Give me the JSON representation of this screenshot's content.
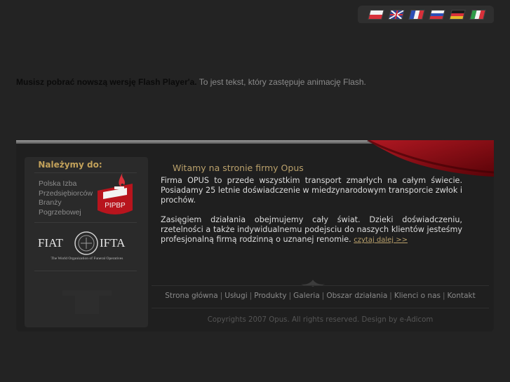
{
  "languages": [
    {
      "code": "pl",
      "icon": "flag-poland-icon"
    },
    {
      "code": "en",
      "icon": "flag-uk-icon"
    },
    {
      "code": "fr",
      "icon": "flag-france-icon"
    },
    {
      "code": "ru",
      "icon": "flag-russia-icon"
    },
    {
      "code": "de",
      "icon": "flag-germany-icon"
    },
    {
      "code": "it",
      "icon": "flag-italy-icon"
    }
  ],
  "flash_notice": {
    "bold": "Musisz pobrać nowszą wersję Flash Player'a.",
    "rest": " To jest tekst, który zastępuje animację Flash."
  },
  "sidebar": {
    "title": "Należymy do:",
    "pipbp_text": "Polska Izba\nPrzedsiębiorców\nBranży\nPogrzebowej",
    "pipbp_logo_text": "PIPBP",
    "fiat_logo": {
      "left": "FIAT",
      "right": "IFTA",
      "tagline": "The World Organization of Funeral Operatives"
    }
  },
  "main": {
    "welcome": "Witamy na stronie firmy Opus",
    "paragraph1": "Firma OPUS to przede wszystkim transport zmarłych na całym świecie. Posiadamy 25 letnie doświadczenie w miedzynarodowym transporcie zwłok i prochów.",
    "paragraph2": "Zasięgiem działania obejmujemy cały świat. Dzieki doświadczeniu, rzetelności a także indywidualnemu podejsciu do naszych klientów jesteśmy profesjonalną firmą rodzinną o uznanej renomie.",
    "read_more": "czytaj dalej >>"
  },
  "footer": {
    "nav": [
      "Strona główna",
      "Usługi",
      "Produkty",
      "Galeria",
      "Obszar działania",
      "Klienci o nas",
      "Kontakt"
    ],
    "separator": "|",
    "copyright": "Copyrights 2007 Opus. All rights reserved. Design by e-Adicom"
  },
  "colors": {
    "background": "#232323",
    "accent_gold": "#b9a06b",
    "accent_red": "#8c0a14"
  }
}
